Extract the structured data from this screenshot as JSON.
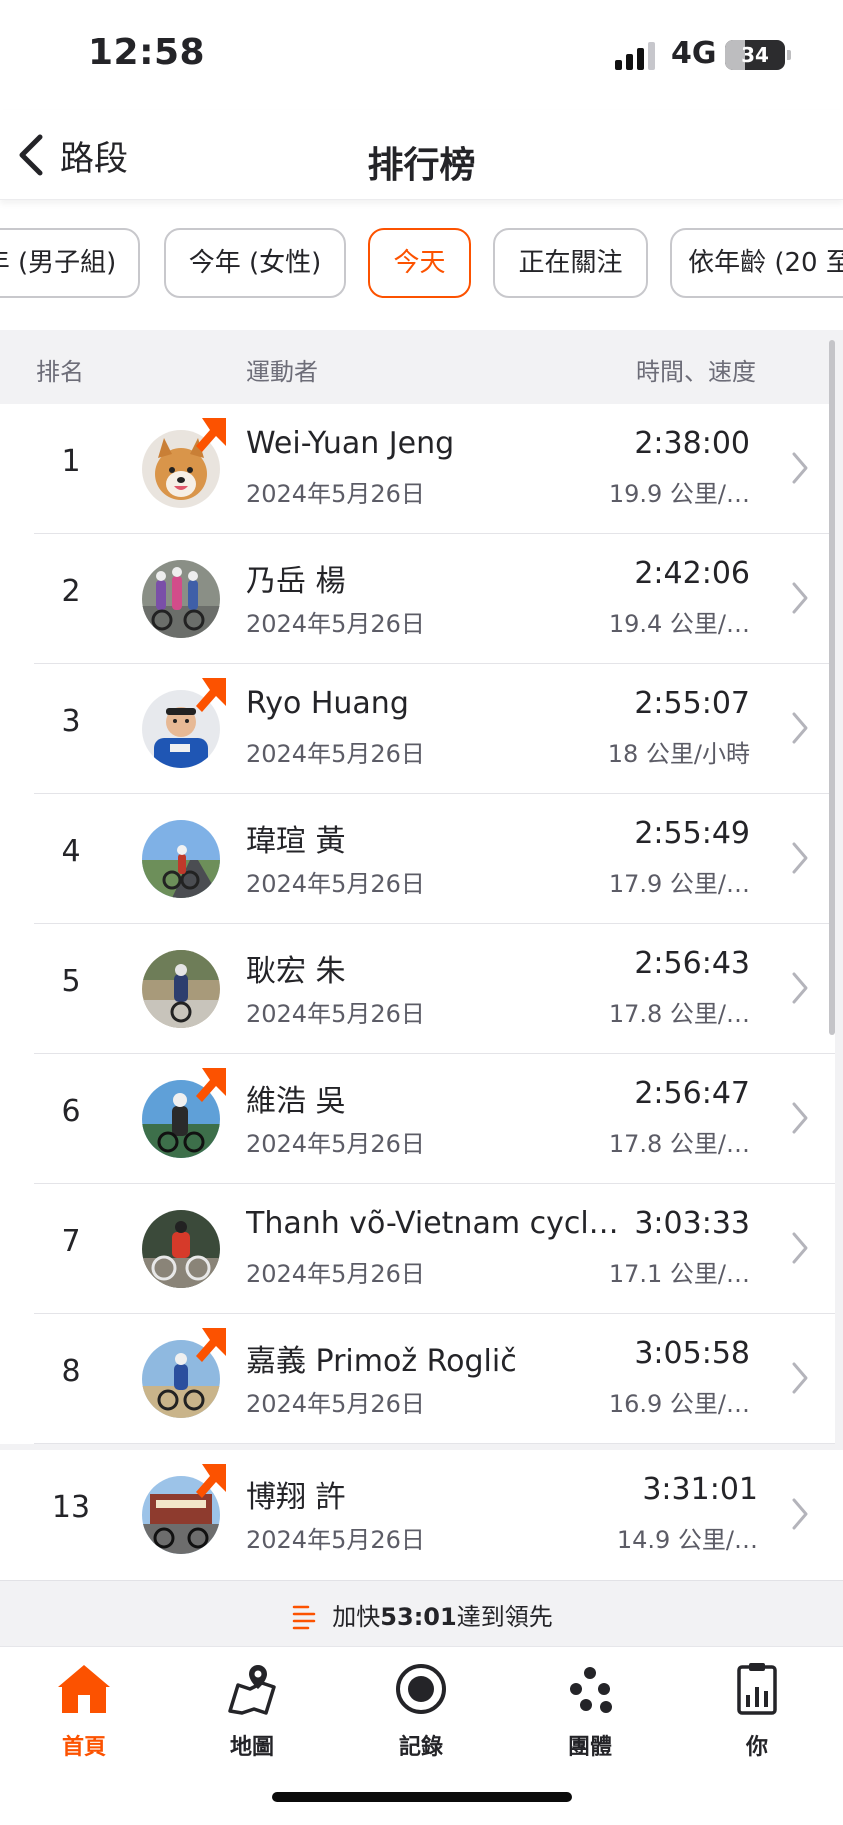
{
  "status": {
    "time": "12:58",
    "network": "4G",
    "battery": "34",
    "battery_level": 0.34
  },
  "nav": {
    "back_label": "路段",
    "title": "排行榜"
  },
  "filters": [
    {
      "label": "年 (男子組)",
      "active": false
    },
    {
      "label": "今年 (女性)",
      "active": false
    },
    {
      "label": "今天",
      "active": true
    },
    {
      "label": "正在關注",
      "active": false
    },
    {
      "label": "依年齡 (20 至",
      "active": false
    }
  ],
  "columns": {
    "rank": "排名",
    "athlete": "運動者",
    "time_speed": "時間、速度"
  },
  "rows": [
    {
      "rank": "1",
      "name": "Wei-Yuan Jeng",
      "date": "2024年5月26日",
      "time": "2:38:00",
      "speed": "19.9 公里/…",
      "badge": true
    },
    {
      "rank": "2",
      "name": "乃岳 楊",
      "date": "2024年5月26日",
      "time": "2:42:06",
      "speed": "19.4 公里/…",
      "badge": false
    },
    {
      "rank": "3",
      "name": "Ryo Huang",
      "date": "2024年5月26日",
      "time": "2:55:07",
      "speed": "18 公里/小時",
      "badge": true
    },
    {
      "rank": "4",
      "name": "瑋瑄 黃",
      "date": "2024年5月26日",
      "time": "2:55:49",
      "speed": "17.9 公里/…",
      "badge": false
    },
    {
      "rank": "5",
      "name": "耿宏 朱",
      "date": "2024年5月26日",
      "time": "2:56:43",
      "speed": "17.8 公里/…",
      "badge": false
    },
    {
      "rank": "6",
      "name": "維浩 吳",
      "date": "2024年5月26日",
      "time": "2:56:47",
      "speed": "17.8 公里/…",
      "badge": true
    },
    {
      "rank": "7",
      "name": "Thanh võ-Vietnam cyclin...",
      "date": "2024年5月26日",
      "time": "3:03:33",
      "speed": "17.1 公里/…",
      "badge": false
    },
    {
      "rank": "8",
      "name": "嘉義 Primož Roglič",
      "date": "2024年5月26日",
      "time": "3:05:58",
      "speed": "16.9 公里/…",
      "badge": true
    }
  ],
  "you": {
    "rank": "13",
    "name": "博翔 許",
    "date": "2024年5月26日",
    "time": "3:31:01",
    "speed": "14.9 公里/…",
    "badge": true
  },
  "pace": {
    "prefix": "加快",
    "amount": "53:01",
    "suffix": "達到領先"
  },
  "tabs": [
    {
      "label": "首頁",
      "icon": "home-icon",
      "active": true
    },
    {
      "label": "地圖",
      "icon": "map-icon",
      "active": false
    },
    {
      "label": "記錄",
      "icon": "record-icon",
      "active": false
    },
    {
      "label": "團體",
      "icon": "groups-icon",
      "active": false
    },
    {
      "label": "你",
      "icon": "profile-icon",
      "active": false
    }
  ],
  "colors": {
    "accent": "#fc5200",
    "text": "#242428",
    "muted": "#5c5c66",
    "section_bg": "#f2f2f4"
  }
}
